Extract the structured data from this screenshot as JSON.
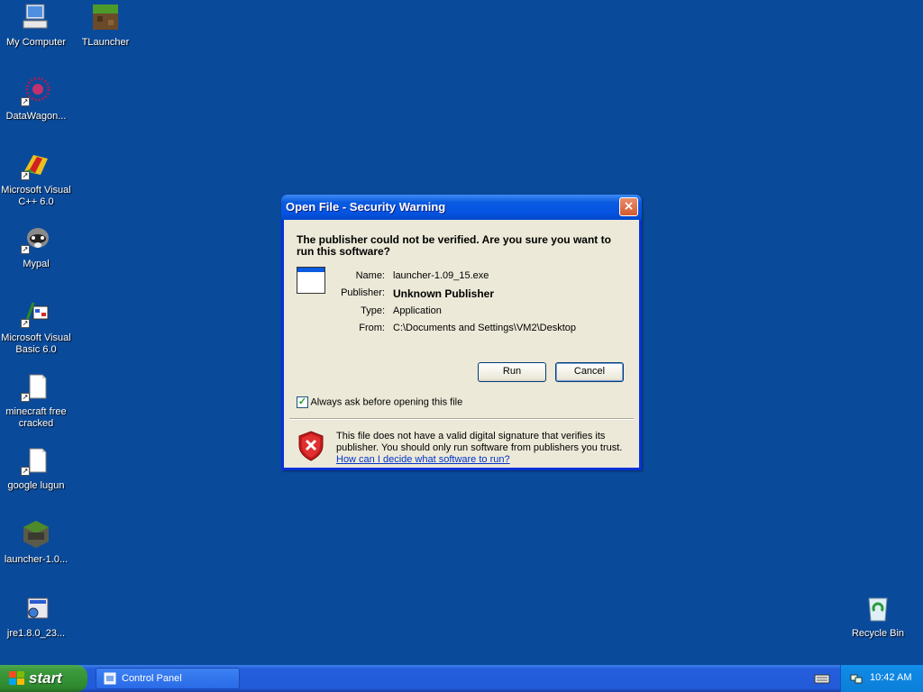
{
  "desktop": {
    "icons": [
      {
        "label": "My Computer",
        "icon": "my-computer-icon"
      },
      {
        "label": "TLauncher",
        "icon": "tlauncher-icon"
      },
      {
        "label": "DataWagon...",
        "icon": "datawagon-icon"
      },
      {
        "label": "Microsoft Visual C++ 6.0",
        "icon": "visual-cpp-icon"
      },
      {
        "label": "Mypal",
        "icon": "mypal-icon"
      },
      {
        "label": "Microsoft Visual Basic 6.0",
        "icon": "visual-basic-icon"
      },
      {
        "label": "minecraft free cracked",
        "icon": "shortcut-file-icon"
      },
      {
        "label": "google lugun",
        "icon": "shortcut-file-icon"
      },
      {
        "label": "launcher-1.0...",
        "icon": "betacraft-icon"
      },
      {
        "label": "jre1.8.0_23...",
        "icon": "installer-icon"
      },
      {
        "label": "Recycle Bin",
        "icon": "recycle-bin-icon"
      }
    ]
  },
  "dialog": {
    "title": "Open File - Security Warning",
    "close_label": "×",
    "question": "The publisher could not be verified.  Are you sure you want to run this software?",
    "fields": {
      "name_label": "Name:",
      "name_value": "launcher-1.09_15.exe",
      "publisher_label": "Publisher:",
      "publisher_value": "Unknown Publisher",
      "type_label": "Type:",
      "type_value": "Application",
      "from_label": "From:",
      "from_value": "C:\\Documents and Settings\\VM2\\Desktop"
    },
    "run_label": "Run",
    "cancel_label": "Cancel",
    "always_ask_label": "Always ask before opening this file",
    "always_ask_checked": true,
    "warning_text": "This file does not have a valid digital signature that verifies its publisher.  You should only run software from publishers you trust.",
    "help_link": "How can I decide what software to run?"
  },
  "taskbar": {
    "start_label": "start",
    "tasks": [
      {
        "label": "Control Panel"
      }
    ],
    "clock": "10:42 AM"
  },
  "colors": {
    "desktop": "#0a4a9a",
    "title_bar": "#0554e3",
    "dialog_face": "#ece9d8",
    "start_green": "#3c9a3c",
    "link": "#0033cc"
  }
}
